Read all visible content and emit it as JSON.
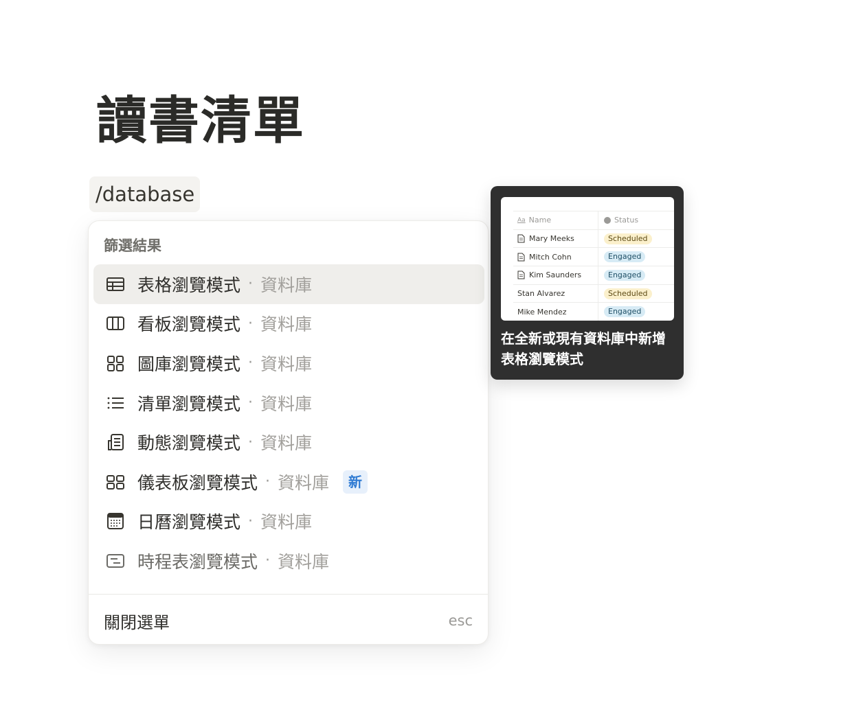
{
  "page": {
    "title": "讀書清單"
  },
  "command_input": {
    "value": "/database"
  },
  "menu": {
    "header": "篩選結果",
    "items": [
      {
        "icon": "table-icon",
        "label": "表格瀏覽模式",
        "sep": "·",
        "sub": "資料庫"
      },
      {
        "icon": "board-icon",
        "label": "看板瀏覽模式",
        "sep": "·",
        "sub": "資料庫"
      },
      {
        "icon": "gallery-icon",
        "label": "圖庫瀏覽模式",
        "sep": "·",
        "sub": "資料庫"
      },
      {
        "icon": "list-icon",
        "label": "清單瀏覽模式",
        "sep": "·",
        "sub": "資料庫"
      },
      {
        "icon": "feed-icon",
        "label": "動態瀏覽模式",
        "sep": "·",
        "sub": "資料庫"
      },
      {
        "icon": "dashboard-icon",
        "label": "儀表板瀏覽模式",
        "sep": "·",
        "sub": "資料庫",
        "badge": "新"
      },
      {
        "icon": "calendar-icon",
        "label": "日曆瀏覽模式",
        "sep": "·",
        "sub": "資料庫"
      },
      {
        "icon": "timeline-icon",
        "label": "時程表瀏覽模式",
        "sep": "·",
        "sub": "資料庫"
      }
    ],
    "footer": {
      "label": "關閉選單",
      "hint": "esc"
    }
  },
  "preview": {
    "table": {
      "headers": {
        "name": "Name",
        "status": "Status"
      },
      "rows": [
        {
          "name": "Mary Meeks",
          "status": "Scheduled"
        },
        {
          "name": "Mitch Cohn",
          "status": "Engaged"
        },
        {
          "name": "Kim Saunders",
          "status": "Engaged"
        },
        {
          "name": "Stan Alvarez",
          "status": "Scheduled"
        },
        {
          "name": "Mike Mendez",
          "status": "Engaged"
        }
      ]
    },
    "caption": "在全新或現有資料庫中新增表格瀏覽模式",
    "colors": {
      "scheduled": "#fbf0cc",
      "engaged": "#d7ebf5"
    }
  },
  "colors": {
    "selected_bg": "#efeeeb",
    "badge_bg": "#e7f0fb",
    "badge_text": "#2f7bd3"
  }
}
